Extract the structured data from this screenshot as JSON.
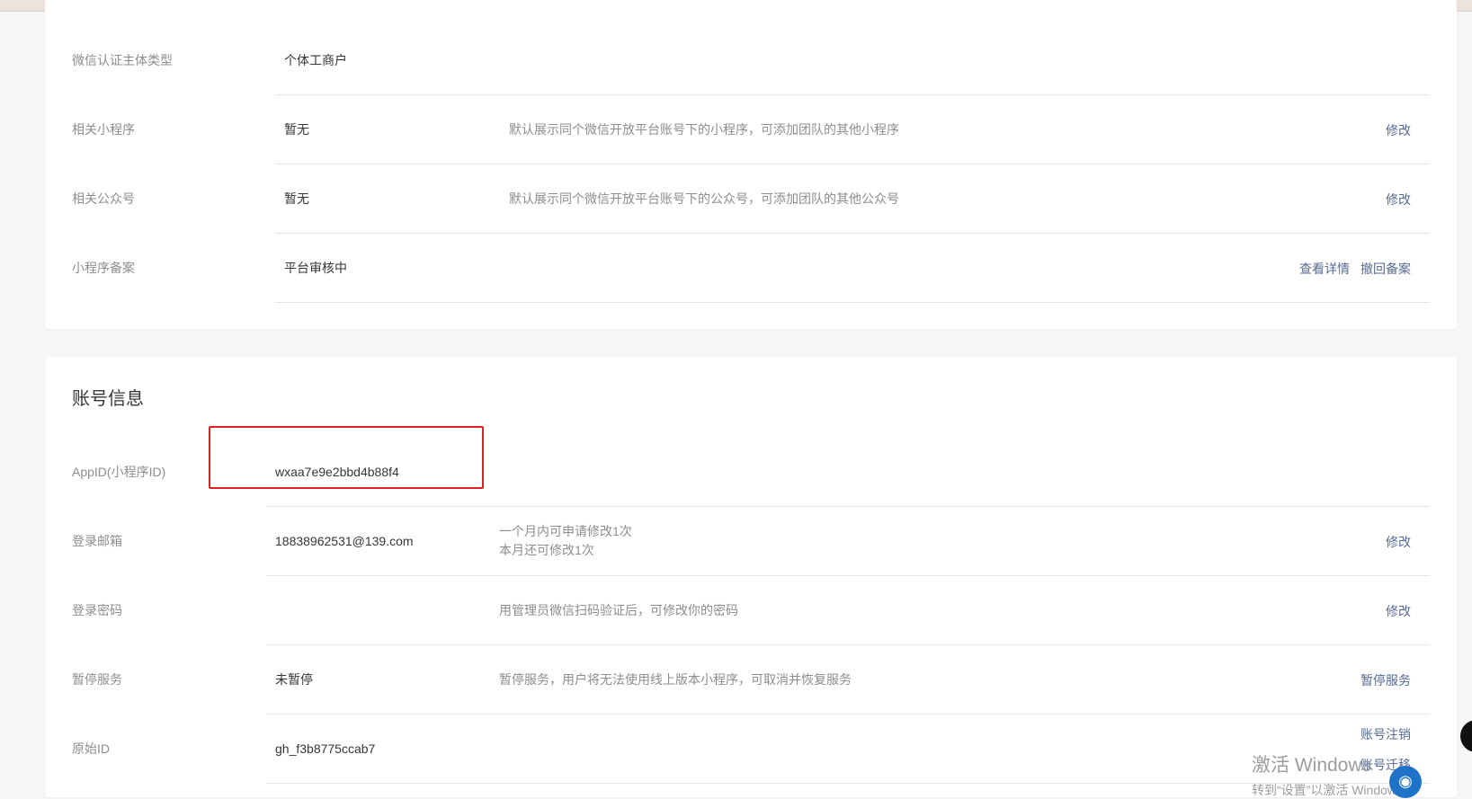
{
  "basic_info": {
    "rows": [
      {
        "label": "微信认证主体类型",
        "value": "个体工商户",
        "desc": "",
        "actions": []
      },
      {
        "label": "相关小程序",
        "value": "暂无",
        "desc": "默认展示同个微信开放平台账号下的小程序，可添加团队的其他小程序",
        "actions": [
          "修改"
        ]
      },
      {
        "label": "相关公众号",
        "value": "暂无",
        "desc": "默认展示同个微信开放平台账号下的公众号，可添加团队的其他公众号",
        "actions": [
          "修改"
        ]
      },
      {
        "label": "小程序备案",
        "value": "平台审核中",
        "desc": "",
        "actions": [
          "查看详情",
          "撤回备案"
        ]
      }
    ]
  },
  "account_info": {
    "title": "账号信息",
    "rows": [
      {
        "label": "AppID(小程序ID)",
        "value": "wxaa7e9e2bbd4b88f4",
        "desc": "",
        "actions": []
      },
      {
        "label": "登录邮箱",
        "value": "18838962531@139.com",
        "desc_lines": [
          "一个月内可申请修改1次",
          "本月还可修改1次"
        ],
        "actions": [
          "修改"
        ]
      },
      {
        "label": "登录密码",
        "value": "",
        "desc": "用管理员微信扫码验证后，可修改你的密码",
        "actions": [
          "修改"
        ]
      },
      {
        "label": "暂停服务",
        "value": "未暂停",
        "desc": "暂停服务，用户将无法使用线上版本小程序，可取消并恢复服务",
        "actions": [
          "暂停服务"
        ]
      },
      {
        "label": "原始ID",
        "value": "gh_f3b8775ccab7",
        "desc": "",
        "actions": [
          "账号注销",
          "账号迁移"
        ]
      }
    ]
  },
  "watermark": {
    "line1": "激活 Windows",
    "line2": "转到“设置”以激活 Windows。"
  },
  "colors": {
    "link": "#576b95",
    "label": "#8d8d8d",
    "highlight": "#e02020",
    "background": "#f6f6f6"
  },
  "icons": {
    "floating_button": "circle-button-icon",
    "assistant": "assistant-icon"
  }
}
